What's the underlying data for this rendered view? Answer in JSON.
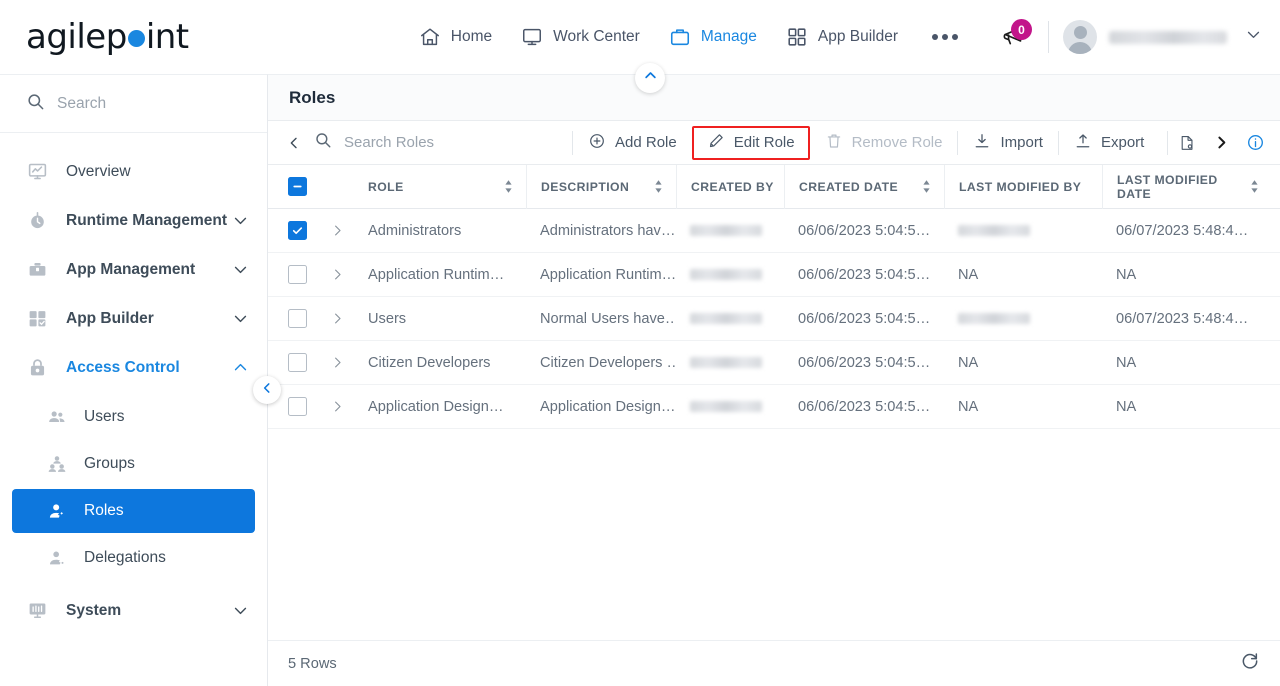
{
  "header": {
    "logo": {
      "pre": "agilep",
      "dot": "o",
      "post": "int",
      "name": "agilepoint"
    },
    "nav": [
      {
        "label": "Home",
        "icon": "home-icon",
        "active": false
      },
      {
        "label": "Work Center",
        "icon": "monitor-icon",
        "active": false
      },
      {
        "label": "Manage",
        "icon": "briefcase-icon",
        "active": true
      },
      {
        "label": "App Builder",
        "icon": "grid-icon",
        "active": false
      }
    ],
    "more_label": "•••",
    "announcements": {
      "icon": "megaphone-icon",
      "badge_count": "0",
      "badge_color": "#c2158a"
    },
    "user": {
      "avatar": "avatar-icon",
      "name_redacted": "",
      "caret": "chevron-down-icon"
    }
  },
  "sidebar": {
    "search_placeholder": "Search",
    "items": [
      {
        "label": "Overview",
        "icon": "overview-chart-icon",
        "expandable": false,
        "state": ""
      },
      {
        "label": "Runtime Management",
        "icon": "stopwatch-icon",
        "expandable": true,
        "state": "collapsed"
      },
      {
        "label": "App Management",
        "icon": "toolbox-icon",
        "expandable": true,
        "state": "collapsed"
      },
      {
        "label": "App Builder",
        "icon": "app-builder-grid-icon",
        "expandable": true,
        "state": "collapsed"
      },
      {
        "label": "Access Control",
        "icon": "lock-icon",
        "expandable": true,
        "state": "expanded"
      }
    ],
    "access_control_children": [
      {
        "label": "Users",
        "icon": "users-icon",
        "selected": false
      },
      {
        "label": "Groups",
        "icon": "groups-icon",
        "selected": false
      },
      {
        "label": "Roles",
        "icon": "roles-icon",
        "selected": true
      },
      {
        "label": "Delegations",
        "icon": "delegations-icon",
        "selected": false
      }
    ],
    "system": {
      "label": "System",
      "icon": "system-monitor-icon",
      "expandable": true,
      "state": "collapsed"
    },
    "collapse_button": "chevron-left-icon",
    "accent_color": "#0d77dd"
  },
  "main": {
    "page_title": "Roles",
    "panel_collapse_icon": "chevron-up-icon",
    "toolbar": {
      "back_icon": "chevron-left-icon",
      "search_placeholder": "Search Roles",
      "search_value": "",
      "buttons": [
        {
          "label": "Add Role",
          "icon": "plus-circle-icon",
          "disabled": false,
          "highlighted": false
        },
        {
          "label": "Edit Role",
          "icon": "pencil-icon",
          "disabled": false,
          "highlighted": true
        },
        {
          "label": "Remove Role",
          "icon": "trash-icon",
          "disabled": true,
          "highlighted": false
        },
        {
          "label": "Import",
          "icon": "import-download-icon",
          "disabled": false,
          "highlighted": false
        },
        {
          "label": "Export",
          "icon": "export-upload-icon",
          "disabled": false,
          "highlighted": false
        }
      ],
      "overflow_report_icon": "report-document-icon",
      "scroll_right_icon": "chevron-right-icon",
      "info_icon": "info-circle-icon",
      "highlight_color": "#ef2020"
    },
    "table": {
      "select_all_state": "indeterminate",
      "columns": [
        {
          "key": "role",
          "label": "ROLE",
          "sortable": true
        },
        {
          "key": "description",
          "label": "DESCRIPTION",
          "sortable": true
        },
        {
          "key": "created_by",
          "label": "CREATED BY",
          "sortable": false
        },
        {
          "key": "created_date",
          "label": "CREATED DATE",
          "sortable": true
        },
        {
          "key": "last_modified_by",
          "label": "LAST MODIFIED BY",
          "sortable": false
        },
        {
          "key": "last_modified_date",
          "label": "LAST MODIFIED DATE",
          "sortable": true
        }
      ],
      "rows": [
        {
          "selected": true,
          "role": "Administrators",
          "description": "Administrators hav…",
          "created_by": "",
          "created_by_redacted": true,
          "created_date": "06/06/2023 5:04:5…",
          "last_modified_by": "",
          "last_modified_by_redacted": true,
          "last_modified_date": "06/07/2023 5:48:4…"
        },
        {
          "selected": false,
          "role": "Application Runtim…",
          "description": "Application Runtim…",
          "created_by": "",
          "created_by_redacted": true,
          "created_date": "06/06/2023 5:04:5…",
          "last_modified_by": "NA",
          "last_modified_by_redacted": false,
          "last_modified_date": "NA"
        },
        {
          "selected": false,
          "role": "Users",
          "description": "Normal Users have…",
          "created_by": "",
          "created_by_redacted": true,
          "created_date": "06/06/2023 5:04:5…",
          "last_modified_by": "",
          "last_modified_by_redacted": true,
          "last_modified_date": "06/07/2023 5:48:4…"
        },
        {
          "selected": false,
          "role": "Citizen Developers",
          "description": "Citizen Developers …",
          "created_by": "",
          "created_by_redacted": true,
          "created_date": "06/06/2023 5:04:5…",
          "last_modified_by": "NA",
          "last_modified_by_redacted": false,
          "last_modified_date": "NA"
        },
        {
          "selected": false,
          "role": "Application Design…",
          "description": "Application Design…",
          "created_by": "",
          "created_by_redacted": true,
          "created_date": "06/06/2023 5:04:5…",
          "last_modified_by": "NA",
          "last_modified_by_redacted": false,
          "last_modified_date": "NA"
        }
      ]
    },
    "status": {
      "rows_label": "5 Rows",
      "refresh_icon": "refresh-icon"
    }
  }
}
